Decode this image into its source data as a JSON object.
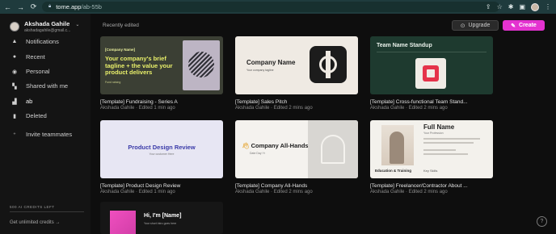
{
  "browser": {
    "url_host": "tome.app",
    "url_path": "/ab-55b"
  },
  "user": {
    "name": "Akshada Gahile",
    "email": "akshadagahile@gmail.c..."
  },
  "sidebar": {
    "items": [
      {
        "label": "Notifications",
        "icon": "bell-icon"
      },
      {
        "label": "Recent",
        "icon": "clock-icon"
      },
      {
        "label": "Personal",
        "icon": "person-icon"
      },
      {
        "label": "Shared with me",
        "icon": "people-icon"
      },
      {
        "label": "ab",
        "icon": "workspace-icon"
      },
      {
        "label": "Deleted",
        "icon": "trash-icon"
      },
      {
        "label": "Invite teammates",
        "icon": "add-person-icon"
      }
    ],
    "credits_title": "500 AI CREDITS LEFT",
    "credits_link": "Get unlimited credits →"
  },
  "main": {
    "section_title": "Recently edited",
    "upgrade_label": "Upgrade",
    "create_label": "Create"
  },
  "cards": [
    {
      "title": "[Template] Fundraising - Series A",
      "meta": "Akshada Gahile · Edited 1 min ago",
      "thumb": {
        "tag": "[Company Name]",
        "headline": "Your company's brief tagline + the value your product delivers",
        "small": "Fund raising"
      }
    },
    {
      "title": "[Template] Sales Pitch",
      "meta": "Akshada Gahile · Edited 2 mins ago",
      "thumb": {
        "name": "Company Name",
        "tag": "Your company tagline"
      }
    },
    {
      "title": "[Template] Cross-functional Team Stand...",
      "meta": "Akshada Gahile · Edited 2 mins ago",
      "thumb": {
        "title": "Team Name Standup"
      }
    },
    {
      "title": "[Template] Product Design Review",
      "meta": "Akshada Gahile · Edited 1 min ago",
      "thumb": {
        "title": "Product Design Review",
        "sub": "Your customer Here"
      }
    },
    {
      "title": "[Template] Company All-Hands",
      "meta": "Akshada Gahile · Edited 2 mins ago",
      "thumb": {
        "name": "Company All-Hands",
        "sub": "Date Day Yr"
      }
    },
    {
      "title": "[Template] Freelancer/Contractor About ...",
      "meta": "Akshada Gahile · Edited 2 mins ago",
      "thumb": {
        "name": "Full Name",
        "role": "Your Profession",
        "edu": "Education & Training",
        "skills": "Key Skills"
      }
    },
    {
      "title": "",
      "meta": "",
      "thumb": {
        "hi": "Hi, I'm [Name]",
        "small": "Your short intro goes here"
      }
    }
  ],
  "colors": {
    "create_button": "#e432d0",
    "app_background": "#0e0e0e",
    "browser_chrome": "#1f3b3d"
  }
}
